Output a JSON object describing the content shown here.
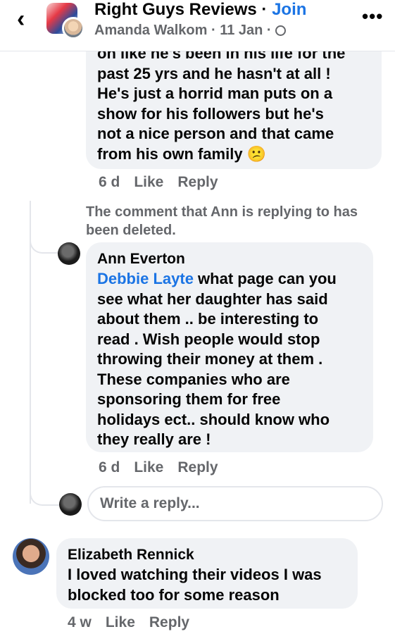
{
  "header": {
    "back_glyph": "‹",
    "group_name": "Right Guys Reviews",
    "separator": " · ",
    "join_label": "Join",
    "post_author": "Amanda Walkom",
    "post_date": "11 Jan",
    "dot": " · ",
    "privacy_icon": "globe-icon",
    "more_glyph": "•••"
  },
  "comment1": {
    "text_lines": [
      "on like he's been in his life for the",
      "past 25 yrs and he hasn't at all !",
      "He's just a horrid man puts on a",
      "show for his followers but he's",
      "not a nice person and that came",
      "from his own family"
    ],
    "emoji": "😕",
    "time": "6 d",
    "like_label": "Like",
    "reply_label": "Reply"
  },
  "deleted_notice": "The comment that Ann is replying to has been deleted.",
  "comment2": {
    "author": "Ann Everton",
    "mention": "Debbie Layte",
    "text_first": " what page can you",
    "text_lines": [
      "see what her daughter has said",
      "about them .. be interesting to",
      "read . Wish people would  stop",
      "throwing their money at them .",
      "These companies who are",
      "sponsoring them for free",
      "holidays ect.. should know who",
      "they really are !"
    ],
    "time": "6 d",
    "like_label": "Like",
    "reply_label": "Reply"
  },
  "reply_input": {
    "placeholder": "Write a reply..."
  },
  "comment3": {
    "author": "Elizabeth Rennick",
    "text_lines": [
      "I loved watching their videos I was",
      "blocked too for some reason"
    ],
    "time": "4 w",
    "like_label": "Like",
    "reply_label": "Reply"
  },
  "colors": {
    "link": "#1b74e4",
    "secondary_text": "#65676b",
    "bubble": "#f0f2f5"
  }
}
